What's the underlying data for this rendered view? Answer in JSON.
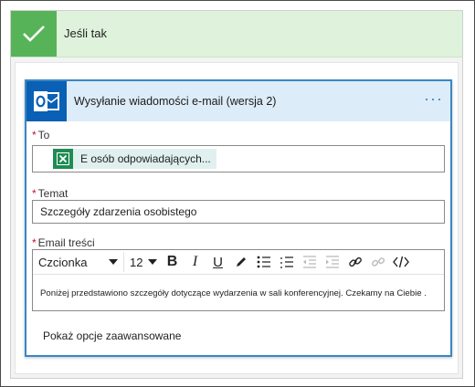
{
  "condition": {
    "title": "Jeśli tak"
  },
  "action": {
    "title": "Wysyłanie wiadomości e-mail (wersja 2)",
    "more": "···"
  },
  "fields": {
    "to": {
      "label": "To",
      "required_mark": "*",
      "token_text": "E osób odpowiadających..."
    },
    "subject": {
      "label": "Temat",
      "required_mark": "*",
      "value": "Szczegóły zdarzenia osobistego"
    },
    "body": {
      "label": "Email treści",
      "required_mark": "*",
      "font": "Czcionka",
      "font_size": "12",
      "value": "Poniżej przedstawiono szczegóły dotyczące wydarzenia w sali konferencyjnej. Czekamy na Ciebie ."
    }
  },
  "advanced_options": "Pokaż opcje zaawansowane",
  "colors": {
    "success_green": "#57b357",
    "accent_blue": "#3b86c5",
    "outlook_blue": "#0a60b4",
    "required_red": "#c4122f"
  }
}
